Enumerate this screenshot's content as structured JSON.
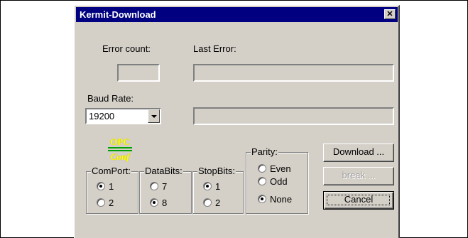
{
  "window": {
    "title": "Kermit-Download",
    "close_glyph": "✕"
  },
  "labels": {
    "error_count": "Error count:",
    "last_error": "Last Error:",
    "baud_rate": "Baud Rate:"
  },
  "baud_rate": {
    "selected": "19200"
  },
  "logo": {
    "top": "OPC",
    "bottom": "Conf"
  },
  "groups": {
    "comport": {
      "title": "ComPort:",
      "options": [
        "1",
        "2"
      ],
      "selected": "1"
    },
    "databits": {
      "title": "DataBits:",
      "options": [
        "7",
        "8"
      ],
      "selected": "8"
    },
    "stopbits": {
      "title": "StopBits:",
      "options": [
        "1",
        "2"
      ],
      "selected": "1"
    },
    "parity": {
      "title": "Parity:",
      "options": [
        "Even",
        "Odd",
        "None"
      ],
      "selected": "None"
    }
  },
  "buttons": {
    "download": "Download ...",
    "break": "break ...",
    "cancel": "Cancel"
  }
}
